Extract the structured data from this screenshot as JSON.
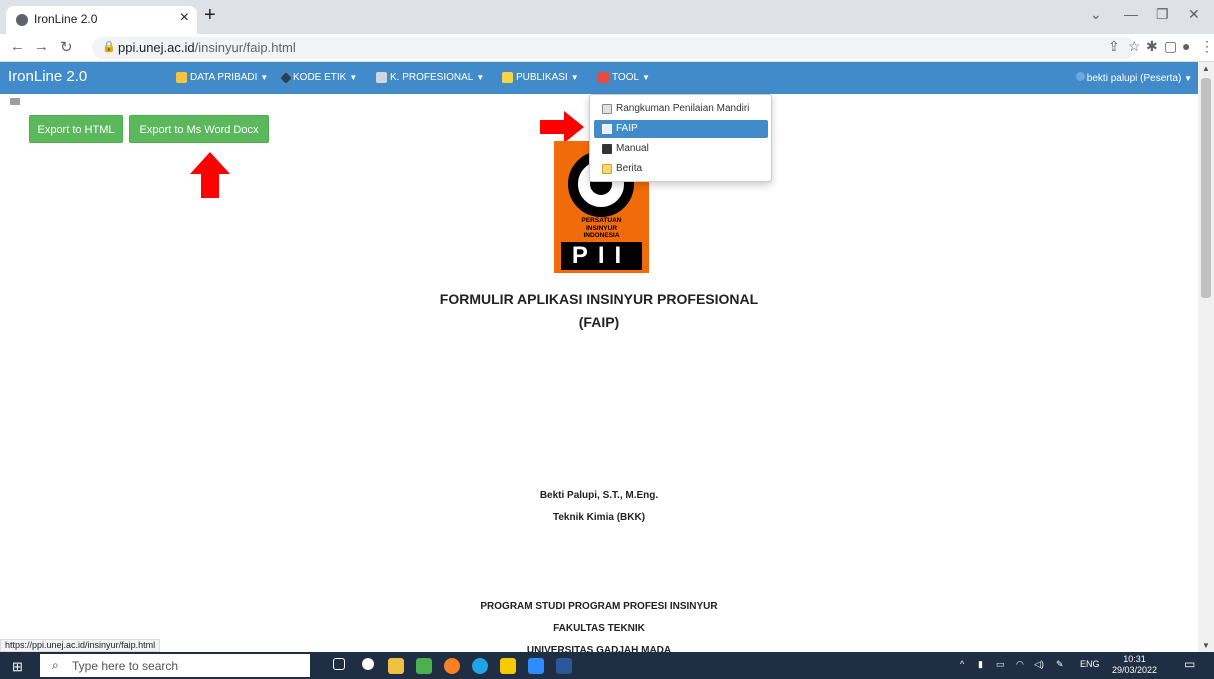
{
  "browser": {
    "tab_title": "IronLine 2.0",
    "tab_close": "×",
    "new_tab": "+",
    "url_host": "ppi.unej.ac.id",
    "url_path": "/insinyur/faip.html",
    "status_url": "https://ppi.unej.ac.id/insinyur/faip.html"
  },
  "nav": {
    "brand": "IronLine 2.0",
    "menus": [
      "DATA PRIBADI",
      "KODE ETIK",
      "K. PROFESIONAL",
      "PUBLIKASI",
      "TOOL"
    ],
    "user": "bekti palupi (Peserta)"
  },
  "buttons": {
    "export_html": "Export to HTML",
    "export_word": "Export to Ms Word Docx"
  },
  "dropdown": {
    "items": [
      "Rangkuman Penilaian Mandiri",
      "FAIP",
      "Manual",
      "Berita"
    ],
    "active_index": 1
  },
  "logo": {
    "line1": "PERSATUAN",
    "line2": "INSINYUR",
    "line3": "INDONESIA",
    "abbr": "PII"
  },
  "document": {
    "title_line1": "FORMULIR APLIKASI INSINYUR PROFESIONAL",
    "title_line2": "(FAIP)",
    "name": "Bekti Palupi, S.T., M.Eng.",
    "dept": "Teknik Kimia (BKK)",
    "program": "PROGRAM STUDI PROGRAM PROFESI INSINYUR",
    "faculty": "FAKULTAS TEKNIK",
    "university": "UNIVERSITAS GADJAH MADA"
  },
  "taskbar": {
    "search_placeholder": "Type here to search",
    "lang": "ENG",
    "time": "10:31",
    "date": "29/03/2022"
  },
  "colors": {
    "navbar": "#428bca",
    "button_green": "#5cb85c",
    "logo_orange": "#f26b0a",
    "annotation_red": "#ff0000"
  }
}
